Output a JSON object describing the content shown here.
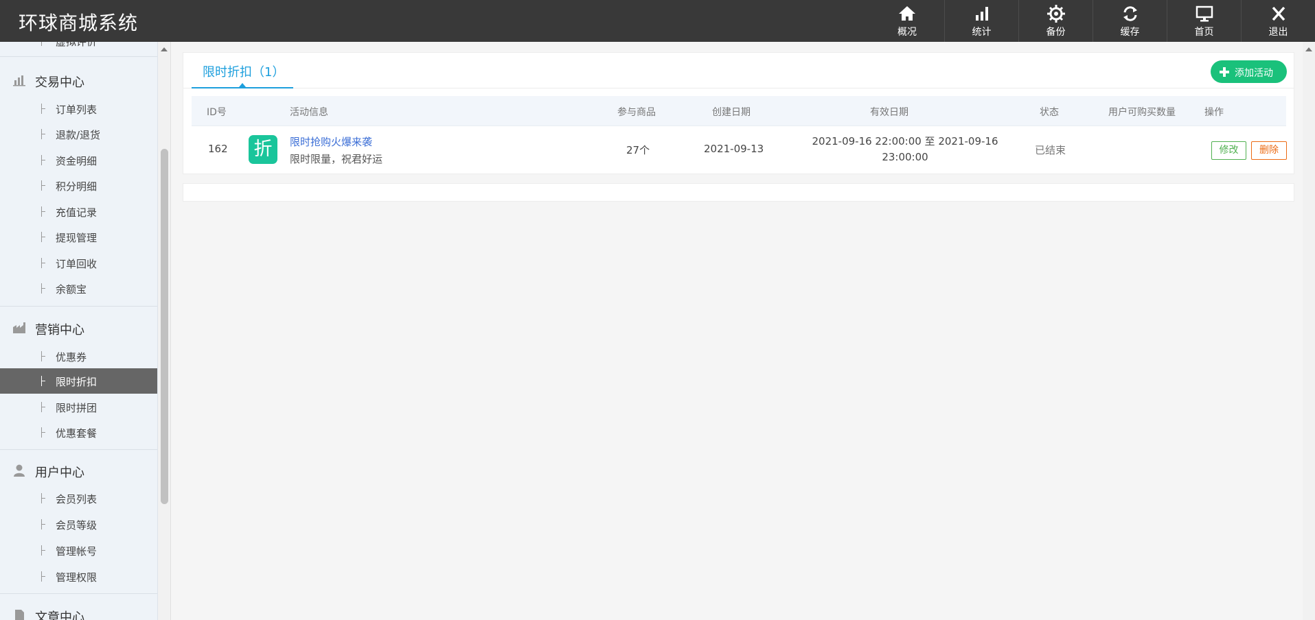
{
  "app": {
    "title": "环球商城系统"
  },
  "topnav": [
    {
      "label": "概况",
      "icon": "home-icon"
    },
    {
      "label": "统计",
      "icon": "bar-chart-icon"
    },
    {
      "label": "备份",
      "icon": "gear-icon"
    },
    {
      "label": "缓存",
      "icon": "refresh-icon"
    },
    {
      "label": "首页",
      "icon": "monitor-icon"
    },
    {
      "label": "退出",
      "icon": "close-icon"
    }
  ],
  "sidebar": {
    "partial_item": "虚拟评价",
    "groups": [
      {
        "label": "交易中心",
        "icon": "bar-chart-icon",
        "items": [
          "订单列表",
          "退款/退货",
          "资金明细",
          "积分明细",
          "充值记录",
          "提现管理",
          "订单回收",
          "余额宝"
        ]
      },
      {
        "label": "营销中心",
        "icon": "factory-icon",
        "items": [
          "优惠券",
          "限时折扣",
          "限时拼团",
          "优惠套餐"
        ],
        "active": "限时折扣"
      },
      {
        "label": "用户中心",
        "icon": "user-icon",
        "items": [
          "会员列表",
          "会员等级",
          "管理帐号",
          "管理权限"
        ]
      },
      {
        "label": "文章中心",
        "icon": "document-icon",
        "items": []
      }
    ]
  },
  "main": {
    "tab_label": "限时折扣（1）",
    "add_button_label": "添加活动",
    "table": {
      "headers": [
        "ID号",
        "活动信息",
        "参与商品",
        "创建日期",
        "有效日期",
        "状态",
        "用户可购买数量",
        "操作"
      ],
      "rows": [
        {
          "id": "162",
          "badge": "折",
          "title": "限时抢购火爆来袭",
          "subtitle": "限时限量，祝君好运",
          "products": "27个",
          "created": "2021-09-13",
          "valid_line1": "2021-09-16 22:00:00 至 2021-09-16",
          "valid_line2": "23:00:00",
          "status": "已结束",
          "qty": "",
          "edit_label": "修改",
          "delete_label": "删除"
        }
      ]
    }
  },
  "colors": {
    "accent": "#1d9fdd",
    "add_button": "#1ac17b",
    "edit": "#4fb04f",
    "delete": "#ec6a13",
    "topbar": "#393939"
  }
}
